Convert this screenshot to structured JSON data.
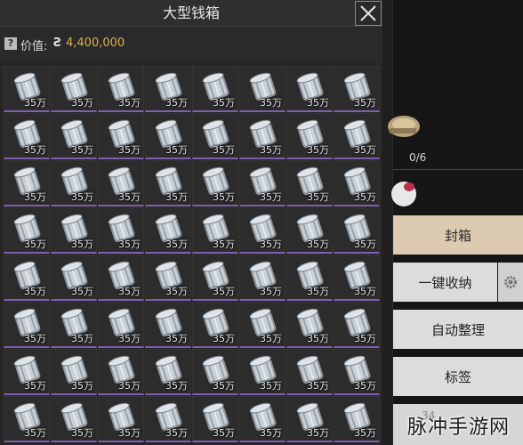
{
  "window": {
    "title": "大型钱箱",
    "close_icon": "close-icon"
  },
  "value_bar": {
    "help_icon": "?",
    "label": "价值:",
    "coin_icon": "Ƨ",
    "amount": "4,400,000"
  },
  "grid": {
    "item_icon": "coin-roll-icon",
    "item_label": "35万",
    "rows": 8,
    "cols": 8
  },
  "side": {
    "slot_count": "0/6",
    "buttons": {
      "seal": "封箱",
      "store_all": "一键收纳",
      "auto_sort": "自动整理",
      "tags": "标签"
    },
    "partial_number": "34"
  },
  "watermark": "脉冲手游网",
  "colors": {
    "seal_button": "#dccbb0",
    "value_amount": "#e0b04a",
    "cell_underline": "#7f5fb0"
  }
}
